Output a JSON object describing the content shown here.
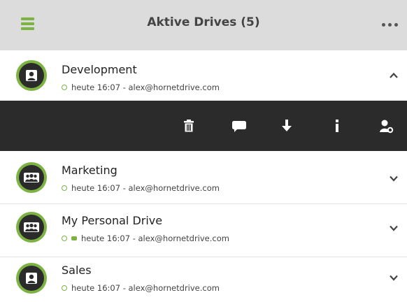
{
  "header": {
    "title": "Aktive Drives (5)",
    "menu_icon": "menu-icon",
    "more_icon": "more-dots-icon"
  },
  "drives": [
    {
      "name": "Development",
      "timestamp": "heute 16:07 - alex@hornetdrive.com",
      "type": "single-user",
      "expanded": true,
      "has_comment": false
    },
    {
      "name": "Marketing",
      "timestamp": "heute 16:07 - alex@hornetdrive.com",
      "type": "group",
      "expanded": false,
      "has_comment": false
    },
    {
      "name": "My Personal Drive",
      "timestamp": "heute 16:07 - alex@hornetdrive.com",
      "type": "group",
      "expanded": false,
      "has_comment": true
    },
    {
      "name": "Sales",
      "timestamp": "heute 16:07 - alex@hornetdrive.com",
      "type": "single-user",
      "expanded": false,
      "has_comment": false
    }
  ],
  "toolbar": {
    "actions": [
      {
        "icon": "trash-icon"
      },
      {
        "icon": "comment-icon"
      },
      {
        "icon": "download-icon"
      },
      {
        "icon": "info-icon"
      },
      {
        "icon": "user-settings-icon"
      }
    ]
  },
  "colors": {
    "accent": "#7cb342",
    "header_bg": "#dcdcdc",
    "toolbar_bg": "#2b2b2b",
    "avatar_inner": "#2b2b2b"
  }
}
